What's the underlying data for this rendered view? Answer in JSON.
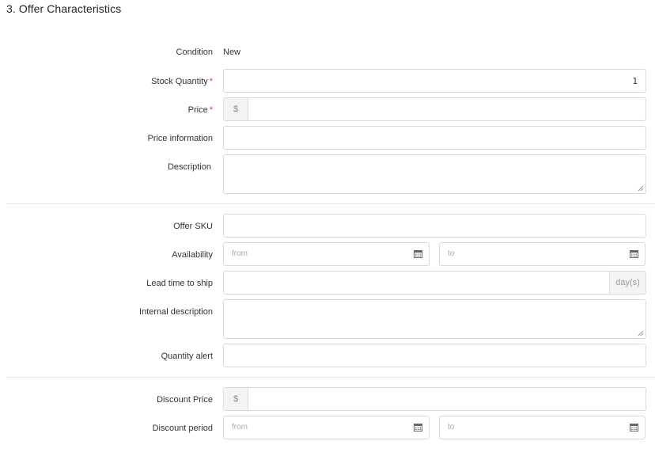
{
  "section": {
    "title": "3. Offer Characteristics"
  },
  "condition": {
    "label": "Condition",
    "value": "New"
  },
  "stock_quantity": {
    "label": "Stock Quantity",
    "required_mark": "*",
    "value": "1"
  },
  "price": {
    "label": "Price",
    "required_mark": "*",
    "currency": "$",
    "value": ""
  },
  "price_information": {
    "label": "Price information",
    "value": ""
  },
  "description": {
    "label": "Description",
    "value": ""
  },
  "offer_sku": {
    "label": "Offer SKU",
    "value": ""
  },
  "availability": {
    "label": "Availability",
    "from_placeholder": "from",
    "to_placeholder": "to"
  },
  "lead_time": {
    "label": "Lead time to ship",
    "unit": "day(s)",
    "value": ""
  },
  "internal_description": {
    "label": "Internal description",
    "value": ""
  },
  "quantity_alert": {
    "label": "Quantity alert",
    "value": ""
  },
  "discount_price": {
    "label": "Discount Price",
    "currency": "$",
    "value": ""
  },
  "discount_period": {
    "label": "Discount period",
    "from_placeholder": "from",
    "to_placeholder": "to"
  },
  "colors": {
    "border": "#d9d9d9",
    "addon_bg": "#f4f4f4",
    "required": "#e53935",
    "divider": "#e3e3e3"
  },
  "icons": {
    "calendar": "calendar-icon",
    "resize": "resize-handle-icon"
  }
}
